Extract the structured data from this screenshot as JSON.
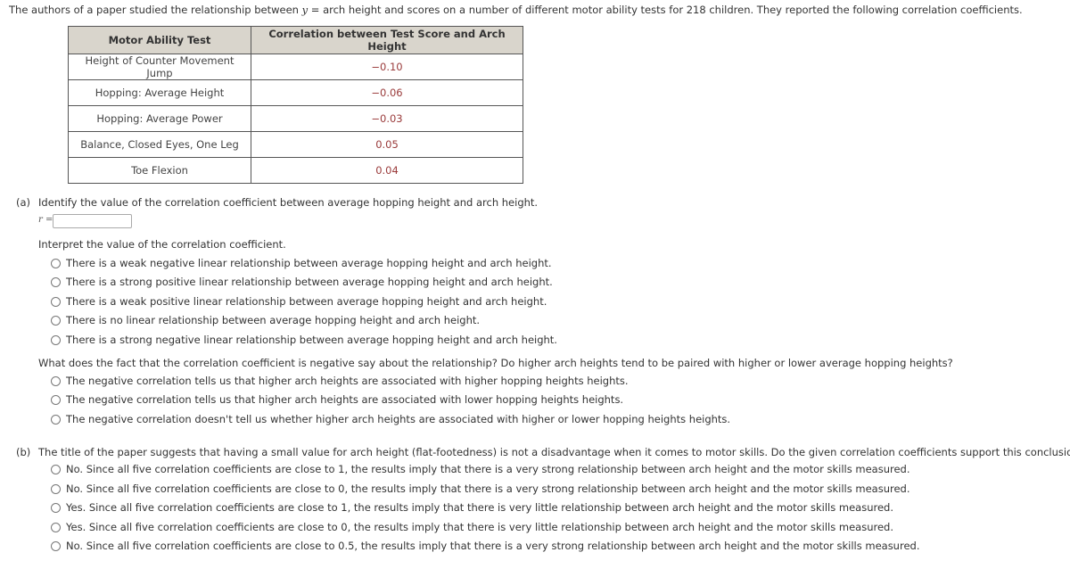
{
  "intro": {
    "before_var": "The authors of a paper studied the relationship between ",
    "var": "y",
    "after_var": " = arch height and scores on a number of different motor ability tests for 218 children. They reported the following correlation coefficients."
  },
  "table": {
    "headers": [
      "Motor Ability Test",
      "Correlation between Test Score and Arch Height"
    ],
    "rows": [
      {
        "test": "Height of Counter Movement Jump",
        "r": "−0.10"
      },
      {
        "test": "Hopping: Average Height",
        "r": "−0.06"
      },
      {
        "test": "Hopping: Average Power",
        "r": "−0.03"
      },
      {
        "test": "Balance, Closed Eyes, One Leg",
        "r": "0.05"
      },
      {
        "test": "Toe Flexion",
        "r": "0.04"
      }
    ]
  },
  "part_a": {
    "label": "(a)",
    "question": "Identify the value of the correlation coefficient between average hopping height and arch height.",
    "r_label": "r =",
    "r_value": "",
    "interpret_prompt": "Interpret the value of the correlation coefficient.",
    "interpret_options": [
      "There is a weak negative linear relationship between average hopping height and arch height.",
      "There is a strong positive linear relationship between average hopping height and arch height.",
      "There is a weak positive linear relationship between average hopping height and arch height.",
      "There is no linear relationship between average hopping height and arch height.",
      "There is a strong negative linear relationship between average hopping height and arch height."
    ],
    "negative_prompt": "What does the fact that the correlation coefficient is negative say about the relationship? Do higher arch heights tend to be paired with higher or lower average hopping heights?",
    "negative_options": [
      "The negative correlation tells us that higher arch heights are associated with higher hopping heights heights.",
      "The negative correlation tells us that higher arch heights are associated with lower hopping heights heights.",
      "The negative correlation doesn't tell us whether higher arch heights are associated with higher or lower hopping heights heights."
    ]
  },
  "part_b": {
    "label": "(b)",
    "question": "The title of the paper suggests that having a small value for arch height (flat-footedness) is not a disadvantage when it comes to motor skills. Do the given correlation coefficients support this conclusion? Explain.",
    "options": [
      "No. Since all five correlation coefficients are close to 1, the results imply that there is a very strong relationship between arch height and the motor skills measured.",
      "No. Since all five correlation coefficients are close to 0, the results imply that there is a very strong relationship between arch height and the motor skills measured.",
      "Yes. Since all five correlation coefficients are close to 1, the results imply that there is very little relationship between arch height and the motor skills measured.",
      "Yes. Since all five correlation coefficients are close to 0, the results imply that there is very little relationship between arch height and the motor skills measured.",
      "No. Since all five correlation coefficients are close to 0.5, the results imply that there is a very strong relationship between arch height and the motor skills measured."
    ]
  }
}
